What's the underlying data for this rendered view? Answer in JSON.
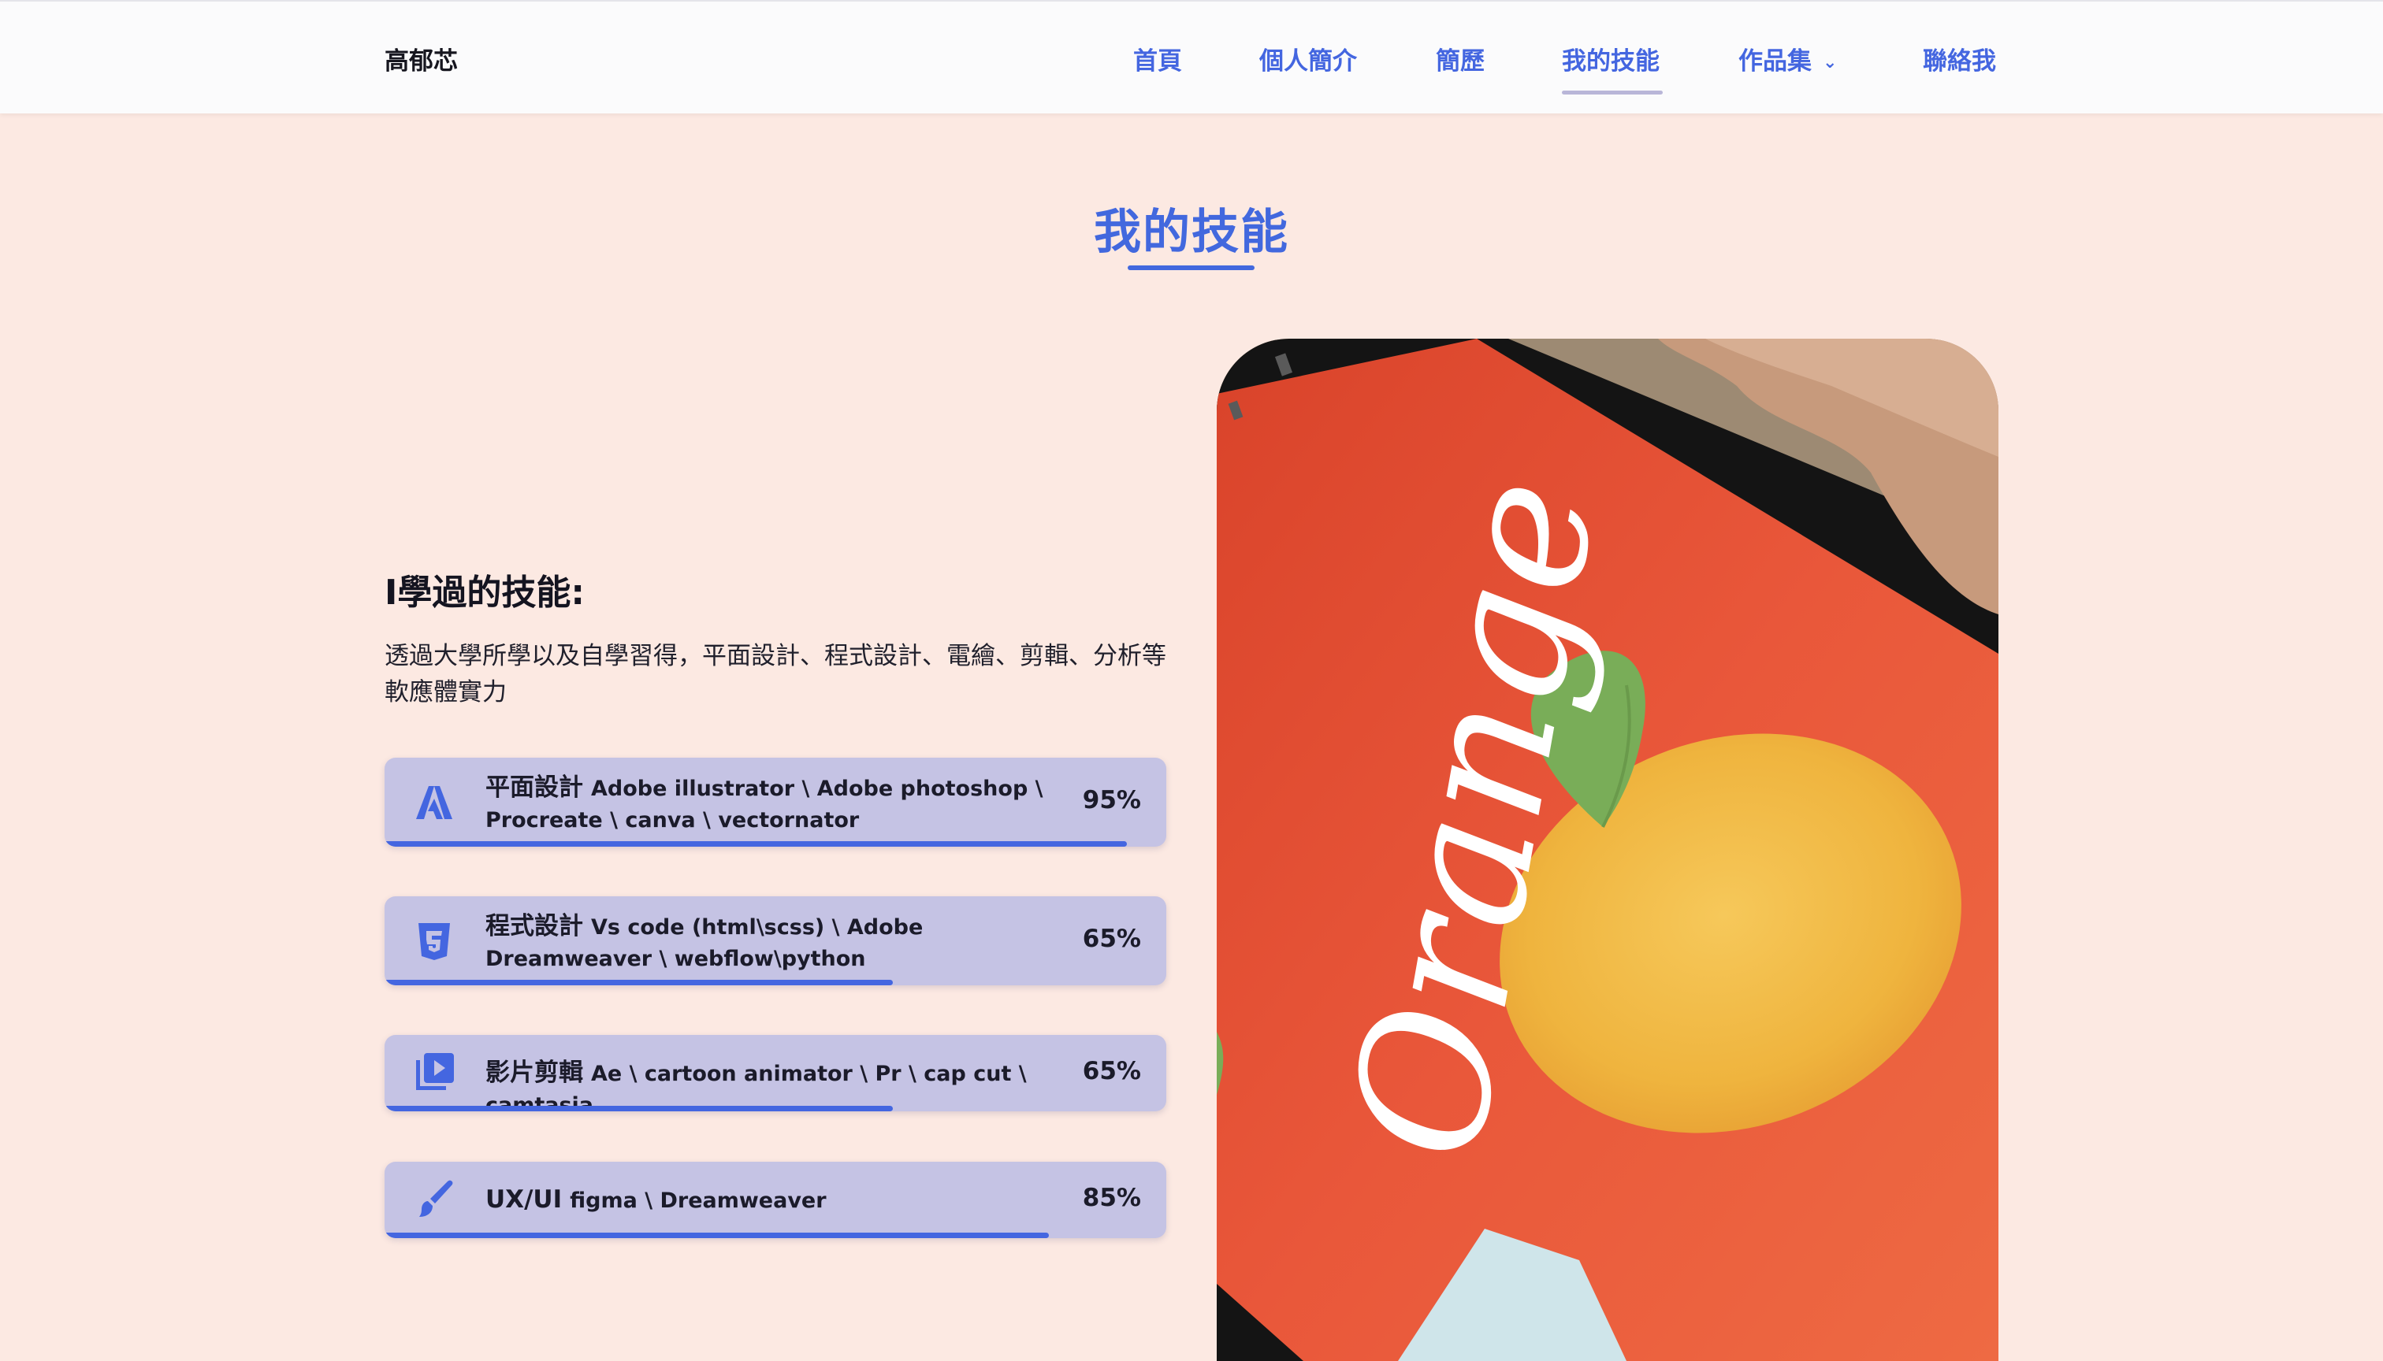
{
  "header": {
    "brand": "高郁芯",
    "nav": [
      {
        "label": "首頁",
        "active": false
      },
      {
        "label": "個人簡介",
        "active": false
      },
      {
        "label": "簡歷",
        "active": false
      },
      {
        "label": "我的技能",
        "active": true
      },
      {
        "label": "作品集",
        "has_dropdown": true
      },
      {
        "label": "聯絡我",
        "active": false
      }
    ]
  },
  "section": {
    "title": "我的技能",
    "sub_heading": "I學過的技能:",
    "description": "透過大學所學以及自學習得，平面設計、程式設計、電繪、剪輯、分析等軟應體實力"
  },
  "skills": [
    {
      "icon": "adobe-icon",
      "category": "平面設計",
      "tools": "Adobe illustrator \\ Adobe photoshop \\ Procreate \\ canva \\ vectornator",
      "percent_label": "95%",
      "percent": 95
    },
    {
      "icon": "css3-icon",
      "category": "程式設計",
      "tools": "Vs code (html\\scss) \\ Adobe Dreamweaver \\ webflow\\python",
      "percent_label": "65%",
      "percent": 65
    },
    {
      "icon": "video-library-icon",
      "category": "影片剪輯",
      "tools": "Ae \\ cartoon animator \\ Pr \\ cap cut \\ camtasia",
      "percent_label": "65%",
      "percent": 65
    },
    {
      "icon": "brush-icon",
      "category": "UX/UI",
      "tools": "figma \\ Dreamweaver",
      "percent_label": "85%",
      "percent": 85
    }
  ],
  "photo": {
    "lettering": "Orange",
    "subject": "tablet-illustration-orange"
  },
  "colors": {
    "background": "#fce9e2",
    "accent": "#4466e0",
    "skill_card": "#c5c3e4",
    "header_bg": "#fbfbfc"
  }
}
